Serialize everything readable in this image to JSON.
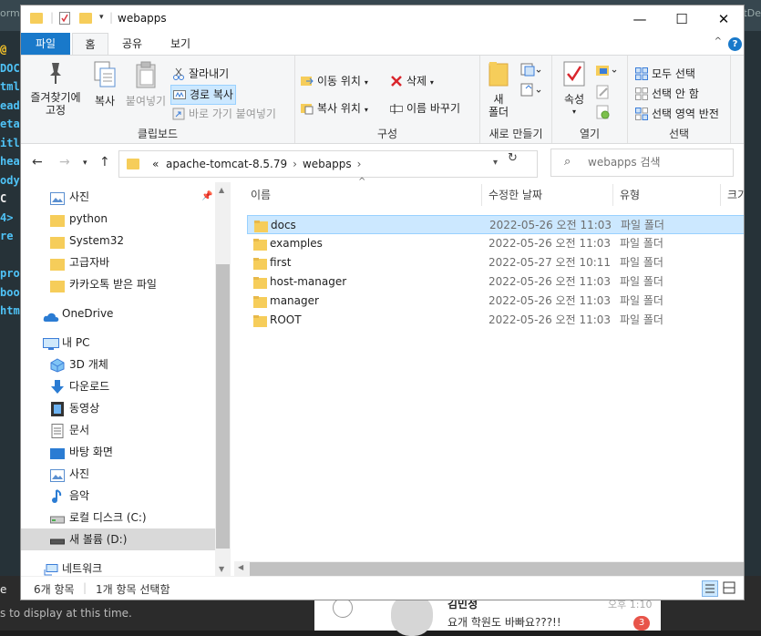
{
  "window": {
    "title": "webapps",
    "controls": {
      "minimize": "—",
      "maximize": "☐",
      "close": "✕"
    }
  },
  "ribbon_tabs": [
    "파일",
    "홈",
    "공유",
    "보기"
  ],
  "ribbon": {
    "clipboard": {
      "label": "클립보드",
      "pin": "즐겨찾기에\n고정",
      "copy": "복사",
      "paste": "붙여넣기",
      "cut": "잘라내기",
      "copy_path": "경로 복사",
      "paste_shortcut": "바로 가기 붙여넣기"
    },
    "organize": {
      "label": "구성",
      "move_to": "이동 위치",
      "copy_to": "복사 위치",
      "delete": "삭제",
      "rename": "이름 바꾸기"
    },
    "new": {
      "label": "새로 만들기",
      "new_folder": "새\n폴더"
    },
    "open": {
      "label": "열기",
      "properties": "속성"
    },
    "select": {
      "label": "선택",
      "select_all": "모두 선택",
      "select_none": "선택 안 함",
      "invert": "선택 영역 반전"
    }
  },
  "address": {
    "prefix": "«",
    "crumbs": [
      "apache-tomcat-8.5.79",
      "webapps"
    ],
    "search_placeholder": "webapps 검색"
  },
  "nav": {
    "quick_access": [
      "사진",
      "python",
      "System32",
      "고급자바",
      "카카오톡 받은 파일"
    ],
    "onedrive": "OneDrive",
    "this_pc": "내 PC",
    "pc_items": [
      "3D 개체",
      "다운로드",
      "동영상",
      "문서",
      "바탕 화면",
      "사진",
      "음악",
      "로컬 디스크 (C:)",
      "새 볼륨 (D:)"
    ],
    "network": "네트워크"
  },
  "columns": {
    "name": "이름",
    "date": "수정한 날짜",
    "type": "유형",
    "size": "크기"
  },
  "files": [
    {
      "name": "docs",
      "date": "2022-05-26 오전 11:03",
      "type": "파일 폴더",
      "selected": true
    },
    {
      "name": "examples",
      "date": "2022-05-26 오전 11:03",
      "type": "파일 폴더",
      "selected": false
    },
    {
      "name": "first",
      "date": "2022-05-27 오전 10:11",
      "type": "파일 폴더",
      "selected": false
    },
    {
      "name": "host-manager",
      "date": "2022-05-26 오전 11:03",
      "type": "파일 폴더",
      "selected": false
    },
    {
      "name": "manager",
      "date": "2022-05-26 오전 11:03",
      "type": "파일 폴더",
      "selected": false
    },
    {
      "name": "ROOT",
      "date": "2022-05-26 오전 11:03",
      "type": "파일 폴더",
      "selected": false
    }
  ],
  "status": {
    "count": "6개 항목",
    "selected": "1개 항목 선택함"
  },
  "background": {
    "editor_tab_left": "orm.j",
    "editor_tab_right": "tDe",
    "code_lines": [
      "@",
      "DOC",
      "tml",
      "ead",
      "eta",
      "itl",
      "hea",
      "ody",
      "C",
      "4>",
      "re",
      "",
      "pro",
      "boo",
      "htm"
    ],
    "panel_tab": "e",
    "panel_close": "✕",
    "panel_msg": "s to display at this time.",
    "chat": {
      "name": "김민정",
      "message": "요개 학원도 바빠요???!!",
      "time": "오후 1:10",
      "badge": "3"
    }
  },
  "colors": {
    "accent": "#1979ca",
    "folder": "#f6cd5a",
    "selection": "#cce8ff"
  }
}
